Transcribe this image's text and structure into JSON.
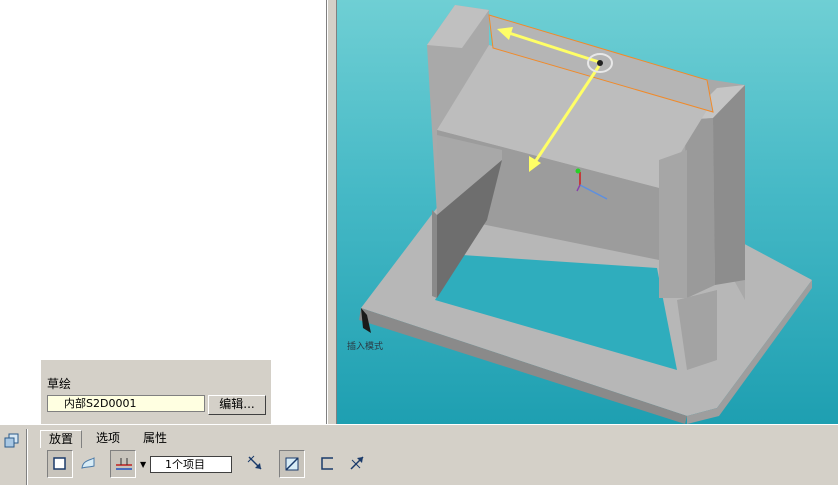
{
  "viewport": {
    "status_text": "插入模式",
    "colors": {
      "bg_top": "#6fcfd4",
      "bg_bottom": "#1e9fb1",
      "part": "#b8b8b8",
      "highlight": "#f08a2a",
      "drag_handle": "#ffff66"
    }
  },
  "sketch": {
    "label": "草绘",
    "field_value": "内部S2D0001",
    "edit_button": "编辑..."
  },
  "dashboard": {
    "tabs": [
      {
        "label": "放置"
      },
      {
        "label": "选项"
      },
      {
        "label": "属性"
      }
    ],
    "references": "1个项目",
    "icons": [
      "solid-icon",
      "surface-icon",
      "flip-side-icon",
      "flip-direction-icon",
      "material-side-icon",
      "thicken-icon",
      "remove-material-icon"
    ]
  }
}
